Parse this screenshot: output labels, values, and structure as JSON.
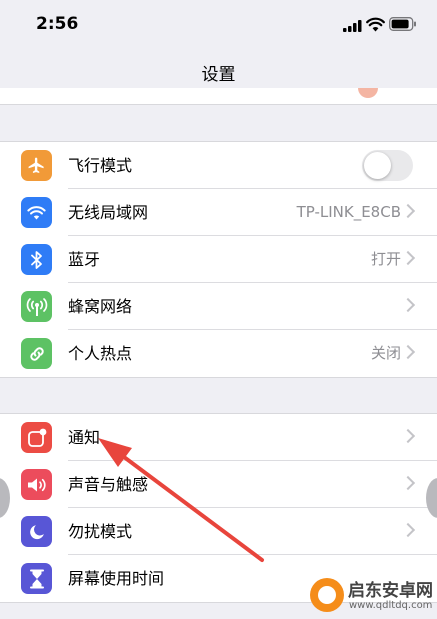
{
  "status": {
    "time": "2:56"
  },
  "nav": {
    "title": "设置"
  },
  "colors": {
    "airplane": "#f19a38",
    "wifi": "#2f7cf6",
    "bluetooth": "#2f7cf6",
    "cellular": "#5dc264",
    "hotspot": "#5dc264",
    "notifications": "#ec4c44",
    "sounds": "#ec4c5c",
    "dnd": "#5856d6",
    "screentime": "#5856d6",
    "annotation_arrow": "#e8453c"
  },
  "group1": {
    "items": [
      {
        "label": "飞行模式",
        "icon": "airplane-icon",
        "toggle_on": false
      },
      {
        "label": "无线局域网",
        "icon": "wifi-icon",
        "value": "TP-LINK_E8CB"
      },
      {
        "label": "蓝牙",
        "icon": "bluetooth-icon",
        "value": "打开"
      },
      {
        "label": "蜂窝网络",
        "icon": "antenna-icon"
      },
      {
        "label": "个人热点",
        "icon": "hotspot-link-icon",
        "value": "关闭"
      }
    ]
  },
  "group2": {
    "items": [
      {
        "label": "通知",
        "icon": "notification-icon"
      },
      {
        "label": "声音与触感",
        "icon": "speaker-icon"
      },
      {
        "label": "勿扰模式",
        "icon": "moon-icon"
      },
      {
        "label": "屏幕使用时间",
        "icon": "hourglass-icon"
      }
    ]
  },
  "watermark": {
    "title": "启东安卓网",
    "url": "www.qdltdq.com"
  }
}
